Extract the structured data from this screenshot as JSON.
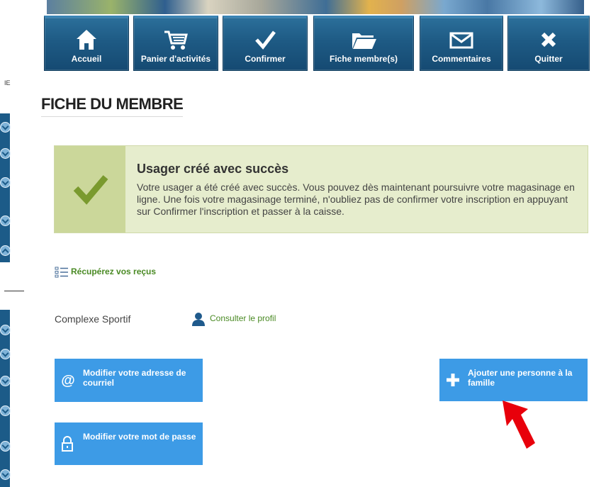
{
  "nav": {
    "tabs": [
      {
        "label": "Accueil",
        "icon": "home-icon"
      },
      {
        "label": "Panier d'activités",
        "icon": "cart-icon"
      },
      {
        "label": "Confirmer",
        "icon": "checkmark-icon"
      },
      {
        "label": "Fiche membre(s)",
        "icon": "folder-icon"
      },
      {
        "label": "Commentaires",
        "icon": "envelope-icon"
      },
      {
        "label": "Quitter",
        "icon": "close-icon"
      }
    ]
  },
  "sidebar": {
    "fragment_text": "IE"
  },
  "page": {
    "title": "FICHE DU MEMBRE"
  },
  "alert": {
    "title": "Usager créé avec succès",
    "message": "Votre usager a été créé avec succès. Vous pouvez dès maintenant poursuivre votre magasinage en ligne. Une fois votre magasinage terminé, n'oubliez pas de confirmer votre inscription en appuyant sur Confirmer l'inscription et passer à la caisse.",
    "icon": "checkmark-icon"
  },
  "receipts": {
    "label": "Récupérez vos reçus",
    "icon": "list-icon"
  },
  "member": {
    "facility": "Complexe Sportif",
    "profile_link": "Consulter le profil",
    "profile_icon": "user-icon"
  },
  "actions": {
    "change_email": "Modifier votre adresse de courriel",
    "change_password": "Modifier votre mot de passe",
    "add_family": "Ajouter une personne à la famille"
  },
  "colors": {
    "nav_blue": "#1e5a84",
    "button_blue": "#3d9be6",
    "success_bg": "#e6edcd",
    "success_icon": "#7a9a2e",
    "link_green": "#4a8a24",
    "annotation_red": "#e8000b"
  }
}
